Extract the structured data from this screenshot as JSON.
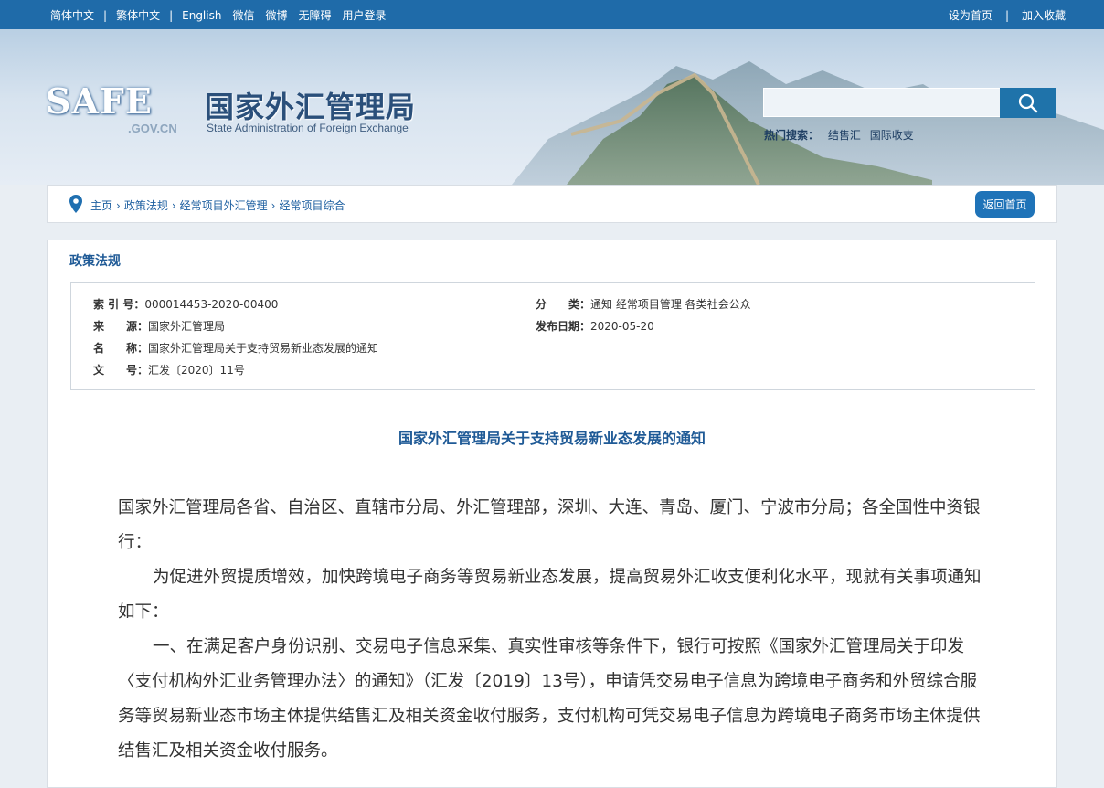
{
  "topbar": {
    "links_left": [
      "简体中文",
      "繁体中文",
      "English",
      "微信",
      "微博",
      "无障碍",
      "用户登录"
    ],
    "links_right": [
      "设为首页",
      "加入收藏"
    ]
  },
  "header": {
    "logo_text": "SAFE",
    "logo_domain": ".GOV.CN",
    "title_cn": "国家外汇管理局",
    "title_en": "State Administration of Foreign Exchange",
    "search": {
      "placeholder": "",
      "icon": "search-icon"
    },
    "hot_search": {
      "label": "热门搜索：",
      "items": [
        "结售汇",
        "国际收支"
      ]
    }
  },
  "breadcrumb": {
    "items": [
      "主页",
      "政策法规",
      "经常项目外汇管理",
      "经常项目综合"
    ],
    "home_button": "返回首页"
  },
  "section": {
    "title": "政策法规"
  },
  "meta": {
    "index_label": "索 引 号：",
    "index_value": "000014453-2020-00400",
    "category_label": "分　　类：",
    "category_value": "通知  经常项目管理  各类社会公众",
    "source_label": "来　　源：",
    "source_value": "国家外汇管理局",
    "date_label": "发布日期：",
    "date_value": "2020-05-20",
    "name_label": "名　　称：",
    "name_value": "国家外汇管理局关于支持贸易新业态发展的通知",
    "docno_label": "文　　号：",
    "docno_value": "汇发〔2020〕11号"
  },
  "document": {
    "title": "国家外汇管理局关于支持贸易新业态发展的通知",
    "paragraphs": [
      "国家外汇管理局各省、自治区、直辖市分局、外汇管理部，深圳、大连、青岛、厦门、宁波市分局；各全国性中资银行：",
      "为促进外贸提质增效，加快跨境电子商务等贸易新业态发展，提高贸易外汇收支便利化水平，现就有关事项通知如下：",
      "一、在满足客户身份识别、交易电子信息采集、真实性审核等条件下，银行可按照《国家外汇管理局关于印发〈支付机构外汇业务管理办法〉的通知》（汇发〔2019〕13号），申请凭交易电子信息为跨境电子商务和外贸综合服务等贸易新业态市场主体提供结售汇及相关资金收付服务，支付机构可凭交易电子信息为跨境电子商务市场主体提供结售汇及相关资金收付服务。"
    ]
  }
}
